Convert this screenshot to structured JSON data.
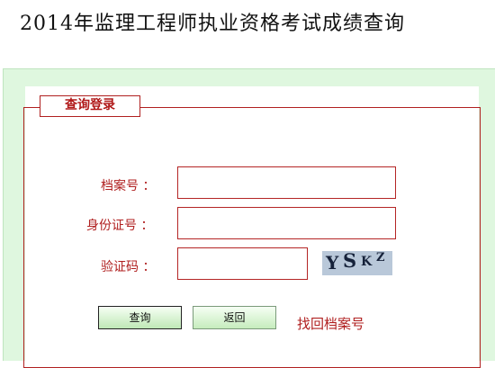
{
  "header": {
    "title": "2014年监理工程师执业资格考试成绩查询"
  },
  "login": {
    "legend": "查询登录",
    "fields": [
      {
        "label": "档案号 ：",
        "value": ""
      },
      {
        "label": "身份证号 ：",
        "value": ""
      },
      {
        "label": "验证码 ：",
        "value": ""
      }
    ],
    "captcha_text": [
      "Y",
      "S",
      "K",
      "Z"
    ],
    "query_button": "查询",
    "back_button": "返回",
    "find_archive_link": "找回档案号"
  },
  "colors": {
    "accent": "#b02020",
    "panel_background": "#dff7df",
    "button_gradient": "#c6ecbd"
  }
}
